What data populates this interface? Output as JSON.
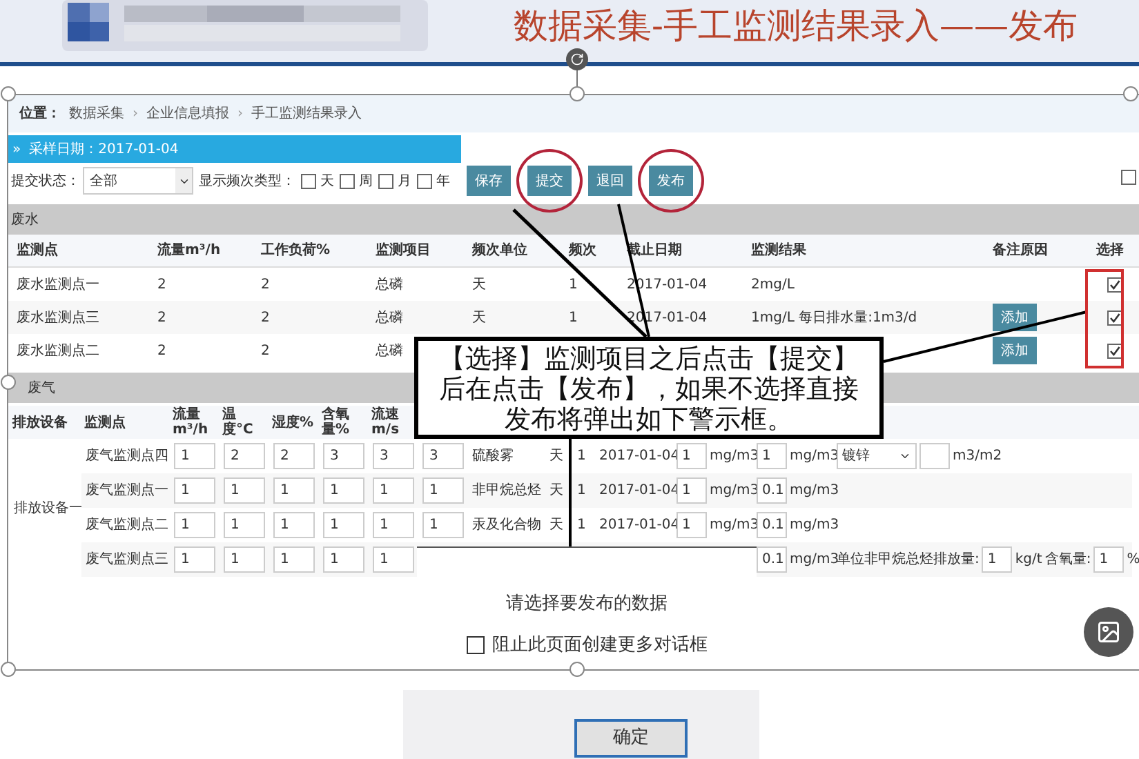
{
  "slide": {
    "title": "数据采集-手工监测结果录入——发布"
  },
  "breadcrumb": {
    "label": "位置：",
    "separator": "›",
    "items": [
      "数据采集",
      "企业信息填报",
      "手工监测结果录入"
    ]
  },
  "date_bar": {
    "marker": "»",
    "label": "采样日期：2017-01-04"
  },
  "toolbar": {
    "status_label": "提交状态：",
    "status_value": "全部",
    "freq_label": "显示频次类型：",
    "freq_options": [
      {
        "label": "天",
        "checked": false
      },
      {
        "label": "周",
        "checked": false
      },
      {
        "label": "月",
        "checked": false
      },
      {
        "label": "年",
        "checked": false
      }
    ],
    "buttons": [
      {
        "label": "保存",
        "highlighted": false
      },
      {
        "label": "提交",
        "highlighted": true
      },
      {
        "label": "退回",
        "highlighted": false
      },
      {
        "label": "发布",
        "highlighted": true
      }
    ],
    "right_checkbox": {
      "checked": false
    }
  },
  "wastewater": {
    "title": "废水",
    "columns": [
      "监测点",
      "流量m³/h",
      "工作负荷%",
      "监测项目",
      "频次单位",
      "频次",
      "截止日期",
      "监测结果",
      "备注原因",
      "选择"
    ],
    "rows": [
      {
        "cells": [
          {
            "kind": "text",
            "text": "废水监测点一"
          },
          {
            "kind": "text",
            "text": "2"
          },
          {
            "kind": "text",
            "text": "2"
          },
          {
            "kind": "text",
            "text": "总磷"
          },
          {
            "kind": "text",
            "text": "天"
          },
          {
            "kind": "text",
            "text": "1"
          },
          {
            "kind": "text",
            "text": "2017-01-04"
          },
          {
            "kind": "text",
            "text": "2mg/L"
          },
          {
            "kind": "hidden"
          },
          {
            "kind": "checkbox",
            "checked": true
          }
        ]
      },
      {
        "cells": [
          {
            "kind": "text",
            "text": "废水监测点三"
          },
          {
            "kind": "text",
            "text": "2"
          },
          {
            "kind": "text",
            "text": "2"
          },
          {
            "kind": "text",
            "text": "总磷"
          },
          {
            "kind": "text",
            "text": "天"
          },
          {
            "kind": "text",
            "text": "1"
          },
          {
            "kind": "text",
            "text": "2017-01-04"
          },
          {
            "kind": "text",
            "text": "1mg/L  每日排水量:1m3/d"
          },
          {
            "kind": "button",
            "text": "添加"
          },
          {
            "kind": "checkbox",
            "checked": true
          }
        ]
      },
      {
        "cells": [
          {
            "kind": "text",
            "text": "废水监测点二"
          },
          {
            "kind": "text",
            "text": "2"
          },
          {
            "kind": "text",
            "text": "2"
          },
          {
            "kind": "text",
            "text": "总磷"
          },
          {
            "kind": "hidden"
          },
          {
            "kind": "hidden"
          },
          {
            "kind": "hidden"
          },
          {
            "kind": "hidden"
          },
          {
            "kind": "button",
            "text": "添加"
          },
          {
            "kind": "checkbox",
            "checked": true
          }
        ]
      }
    ]
  },
  "wastegas": {
    "title": "废气",
    "columns": [
      {
        "kind": "text",
        "text": "排放设备"
      },
      {
        "kind": "text",
        "text": "监测点"
      },
      {
        "kind": "text",
        "text": "流量m³/h"
      },
      {
        "kind": "text",
        "text": "温度°C"
      },
      {
        "kind": "text",
        "text": "湿度%"
      },
      {
        "kind": "text",
        "text": "含氧量%"
      },
      {
        "kind": "text",
        "text": "流速m/s"
      },
      {
        "kind": "hidden"
      },
      {
        "kind": "hidden"
      },
      {
        "kind": "hidden"
      },
      {
        "kind": "hidden"
      },
      {
        "kind": "hidden"
      },
      {
        "kind": "hidden"
      },
      {
        "kind": "hidden"
      }
    ],
    "rows": [
      {
        "cells": [
          {
            "kind": "text",
            "text": "排放设备一",
            "rowspan": 4
          },
          {
            "kind": "text",
            "text": "废气监测点四"
          },
          {
            "kind": "input",
            "value": "1"
          },
          {
            "kind": "input",
            "value": "2"
          },
          {
            "kind": "input",
            "value": "2"
          },
          {
            "kind": "input",
            "value": "3"
          },
          {
            "kind": "input",
            "value": "3"
          },
          {
            "kind": "input",
            "value": "3"
          },
          {
            "kind": "text",
            "text": "硫酸雾"
          },
          {
            "kind": "text",
            "text": "天"
          },
          {
            "kind": "text",
            "text": "1"
          },
          {
            "kind": "text",
            "text": "2017-01-04"
          },
          {
            "kind": "group",
            "parts": [
              {
                "kind": "input",
                "value": "1"
              },
              {
                "kind": "text",
                "text": "mg/m3"
              }
            ]
          },
          {
            "kind": "group",
            "parts": [
              {
                "kind": "input",
                "value": "1"
              },
              {
                "kind": "text",
                "text": "mg/m3"
              }
            ]
          },
          {
            "kind": "group",
            "parts": [
              {
                "kind": "select",
                "value": "镀锌"
              },
              {
                "kind": "input"
              },
              {
                "kind": "text",
                "text": "m3/m2"
              }
            ]
          }
        ]
      },
      {
        "cells": [
          {
            "kind": "text",
            "text": "废气监测点一"
          },
          {
            "kind": "input",
            "value": "1"
          },
          {
            "kind": "input",
            "value": "1"
          },
          {
            "kind": "input",
            "value": "1"
          },
          {
            "kind": "input",
            "value": "1"
          },
          {
            "kind": "input",
            "value": "1"
          },
          {
            "kind": "input",
            "value": "1"
          },
          {
            "kind": "text",
            "text": "非甲烷总烃"
          },
          {
            "kind": "text",
            "text": "天"
          },
          {
            "kind": "text",
            "text": "1"
          },
          {
            "kind": "text",
            "text": "2017-01-04"
          },
          {
            "kind": "group",
            "parts": [
              {
                "kind": "input",
                "value": "1"
              },
              {
                "kind": "text",
                "text": "mg/m3"
              }
            ]
          },
          {
            "kind": "group",
            "parts": [
              {
                "kind": "input",
                "value": "0.1"
              },
              {
                "kind": "text",
                "text": "mg/m3"
              }
            ]
          },
          {
            "kind": "hidden"
          }
        ]
      },
      {
        "cells": [
          {
            "kind": "text",
            "text": "废气监测点二"
          },
          {
            "kind": "input",
            "value": "1"
          },
          {
            "kind": "input",
            "value": "1"
          },
          {
            "kind": "input",
            "value": "1"
          },
          {
            "kind": "input",
            "value": "1"
          },
          {
            "kind": "input",
            "value": "1"
          },
          {
            "kind": "input",
            "value": "1"
          },
          {
            "kind": "text",
            "text": "汞及化合物"
          },
          {
            "kind": "text",
            "text": "天"
          },
          {
            "kind": "text",
            "text": "1"
          },
          {
            "kind": "text",
            "text": "2017-01-04"
          },
          {
            "kind": "group",
            "parts": [
              {
                "kind": "input",
                "value": "1"
              },
              {
                "kind": "text",
                "text": "mg/m3"
              }
            ]
          },
          {
            "kind": "group",
            "parts": [
              {
                "kind": "input",
                "value": "0.1"
              },
              {
                "kind": "text",
                "text": "mg/m3"
              }
            ]
          },
          {
            "kind": "hidden"
          }
        ]
      },
      {
        "cells": [
          {
            "kind": "text",
            "text": "废气监测点三"
          },
          {
            "kind": "input",
            "value": "1"
          },
          {
            "kind": "input",
            "value": "1"
          },
          {
            "kind": "input",
            "value": "1"
          },
          {
            "kind": "input",
            "value": "1"
          },
          {
            "kind": "input",
            "value": "1"
          },
          {
            "kind": "hidden"
          },
          {
            "kind": "hidden"
          },
          {
            "kind": "hidden"
          },
          {
            "kind": "hidden"
          },
          {
            "kind": "hidden"
          },
          {
            "kind": "hidden"
          },
          {
            "kind": "group",
            "parts": [
              {
                "kind": "input",
                "value": "0.1"
              },
              {
                "kind": "text",
                "text": "mg/m3"
              }
            ]
          },
          {
            "kind": "group",
            "parts": [
              {
                "kind": "text",
                "text": "单位非甲烷总烃排放量:"
              },
              {
                "kind": "input",
                "value": "1"
              },
              {
                "kind": "text",
                "text": "kg/t"
              },
              {
                "kind": "text",
                "text": "含氧量:"
              },
              {
                "kind": "input",
                "value": "1"
              },
              {
                "kind": "text",
                "text": "%"
              }
            ]
          }
        ]
      }
    ]
  },
  "callout": {
    "text": "【选择】监测项目之后点击【提交】后在点击【发布】，如果不选择直接发布将弹出如下警示框。"
  },
  "dialog": {
    "message": "请选择要发布的数据",
    "checkbox": {
      "label": "阻止此页面创建更多对话框",
      "checked": false
    },
    "button": "确定"
  }
}
